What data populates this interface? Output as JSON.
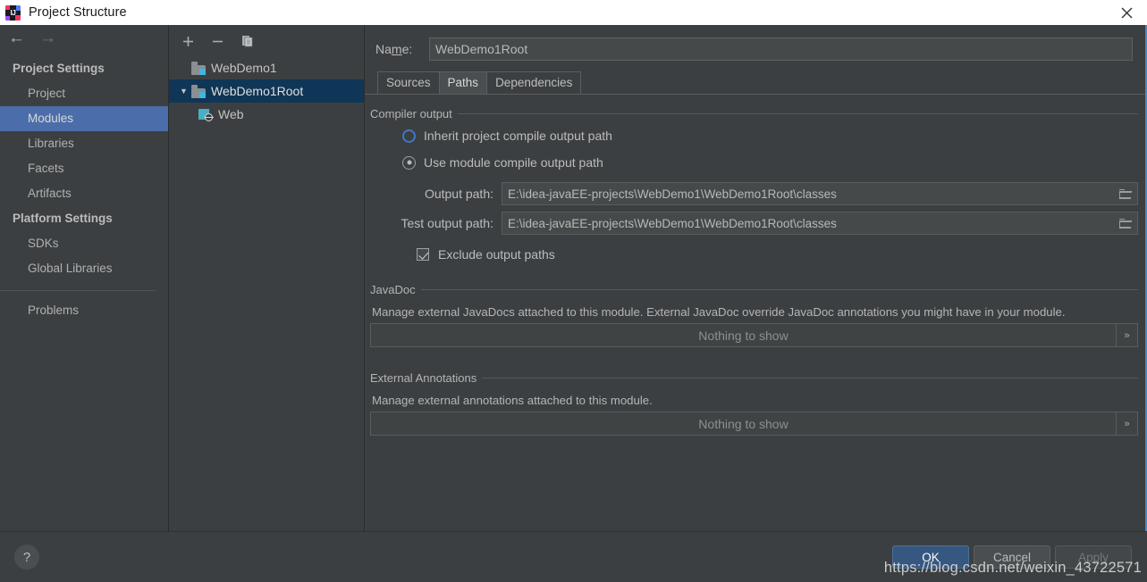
{
  "window": {
    "title": "Project Structure",
    "app_icon": "intellij-idea-icon",
    "close_icon": "close-icon"
  },
  "navigation": {
    "back_icon": "arrow-left-icon",
    "forward_icon": "arrow-right-icon"
  },
  "sidebar": {
    "groups": [
      {
        "title": "Project Settings",
        "items": [
          {
            "label": "Project",
            "selected": false
          },
          {
            "label": "Modules",
            "selected": true
          },
          {
            "label": "Libraries",
            "selected": false
          },
          {
            "label": "Facets",
            "selected": false
          },
          {
            "label": "Artifacts",
            "selected": false
          }
        ]
      },
      {
        "title": "Platform Settings",
        "items": [
          {
            "label": "SDKs",
            "selected": false
          },
          {
            "label": "Global Libraries",
            "selected": false
          }
        ]
      }
    ],
    "problems": {
      "label": "Problems",
      "selected": false
    },
    "selection_color": "#4b6eaa"
  },
  "tree": {
    "toolbar": [
      {
        "name": "add-module-button",
        "icon": "plus-icon"
      },
      {
        "name": "remove-module-button",
        "icon": "minus-icon"
      },
      {
        "name": "copy-module-button",
        "icon": "copy-icon"
      }
    ],
    "items": [
      {
        "label": "WebDemo1",
        "icon": "module-folder-icon",
        "selected": false,
        "expandable": false,
        "indent": false
      },
      {
        "label": "WebDemo1Root",
        "icon": "module-folder-icon",
        "selected": true,
        "expandable": true,
        "expanded": true,
        "indent": false,
        "twisty": "▼"
      },
      {
        "label": "Web",
        "icon": "web-facet-icon",
        "selected": false,
        "expandable": false,
        "indent": true
      }
    ],
    "selection_color": "#0f3656"
  },
  "main": {
    "name_label": "Na",
    "name_label_mnemonic": "m",
    "name_label_rest": "e:",
    "name_value": "WebDemo1Root",
    "tabs": [
      {
        "label": "Sources",
        "active": false
      },
      {
        "label": "Paths",
        "active": true
      },
      {
        "label": "Dependencies",
        "active": false
      }
    ],
    "compiler_output": {
      "section_title": "Compiler output",
      "radios": [
        {
          "label": "Inherit project compile output path",
          "checked": false,
          "focused": true
        },
        {
          "label": "Use module compile output path",
          "checked": true,
          "focused": false
        }
      ],
      "output_path_label": "Output path:",
      "output_path_value": "E:\\idea-javaEE-projects\\WebDemo1\\WebDemo1Root\\classes",
      "test_output_path_label": "Test output path:",
      "test_output_path_value": "E:\\idea-javaEE-projects\\WebDemo1\\WebDemo1Root\\classes",
      "browse_icon": "folder-browse-icon",
      "exclude_checkbox_label": "Exclude output paths",
      "exclude_checkbox_checked": true
    },
    "javadoc": {
      "section_title": "JavaDoc",
      "description": "Manage external JavaDocs attached to this module. External JavaDoc override JavaDoc annotations you might have in your module.",
      "empty_text": "Nothing to show",
      "expand_icon": "»"
    },
    "external_annotations": {
      "section_title": "External Annotations",
      "description": "Manage external annotations attached to this module.",
      "empty_text": "Nothing to show",
      "expand_icon": "»"
    }
  },
  "footer": {
    "help_label": "?",
    "buttons": [
      {
        "label": "OK",
        "style": "default"
      },
      {
        "label": "Cancel",
        "style": "normal"
      },
      {
        "label": "Apply",
        "style": "disabled"
      }
    ]
  },
  "watermark": "https://blog.csdn.net/weixin_43722571",
  "colors": {
    "background": "#3c3f41",
    "accent_blue": "#4b6eaa",
    "tree_selection": "#0f3656",
    "default_button": "#365880",
    "focus_ring": "#3d78c8"
  }
}
